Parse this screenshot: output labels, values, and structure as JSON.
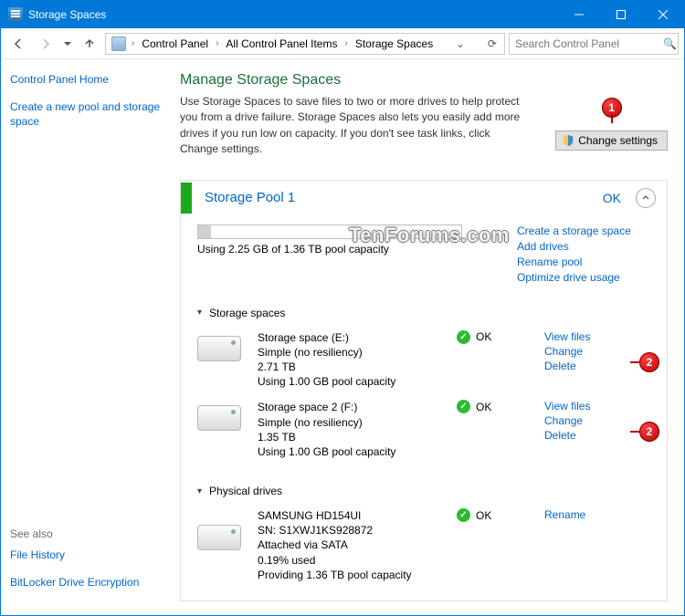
{
  "window": {
    "title": "Storage Spaces"
  },
  "toolbar": {
    "breadcrumbs": [
      "Control Panel",
      "All Control Panel Items",
      "Storage Spaces"
    ],
    "search_placeholder": "Search Control Panel"
  },
  "sidebar": {
    "links": [
      {
        "label": "Control Panel Home"
      },
      {
        "label": "Create a new pool and storage space"
      }
    ],
    "see_also_label": "See also",
    "see_also": [
      {
        "label": "File History"
      },
      {
        "label": "BitLocker Drive Encryption"
      }
    ]
  },
  "main": {
    "heading": "Manage Storage Spaces",
    "description": "Use Storage Spaces to save files to two or more drives to help protect you from a drive failure. Storage Spaces also lets you easily add more drives if you run low on capacity. If you don't see task links, click Change settings.",
    "change_settings_label": "Change settings"
  },
  "pool": {
    "name": "Storage Pool 1",
    "status": "OK",
    "usage_text": "Using 2.25 GB of 1.36 TB pool capacity",
    "right_links": [
      "Create a storage space",
      "Add drives",
      "Rename pool",
      "Optimize drive usage"
    ],
    "storage_spaces_label": "Storage spaces",
    "physical_drives_label": "Physical drives",
    "spaces": [
      {
        "name": "Storage space (E:)",
        "resiliency": "Simple (no resiliency)",
        "size": "2.71 TB",
        "usage": "Using 1.00 GB pool capacity",
        "status": "OK",
        "links": [
          "View files",
          "Change",
          "Delete"
        ]
      },
      {
        "name": "Storage space 2 (F:)",
        "resiliency": "Simple (no resiliency)",
        "size": "1.35 TB",
        "usage": "Using 1.00 GB pool capacity",
        "status": "OK",
        "links": [
          "View files",
          "Change",
          "Delete"
        ]
      }
    ],
    "drives": [
      {
        "name": "SAMSUNG HD154UI",
        "serial": "SN: S1XWJ1KS928872",
        "attach": "Attached via SATA",
        "used": "0.19% used",
        "provide": "Providing 1.36 TB pool capacity",
        "status": "OK",
        "links": [
          "Rename"
        ]
      }
    ]
  },
  "annotations": {
    "one": "1",
    "two": "2"
  },
  "watermark": "TenForums.com"
}
